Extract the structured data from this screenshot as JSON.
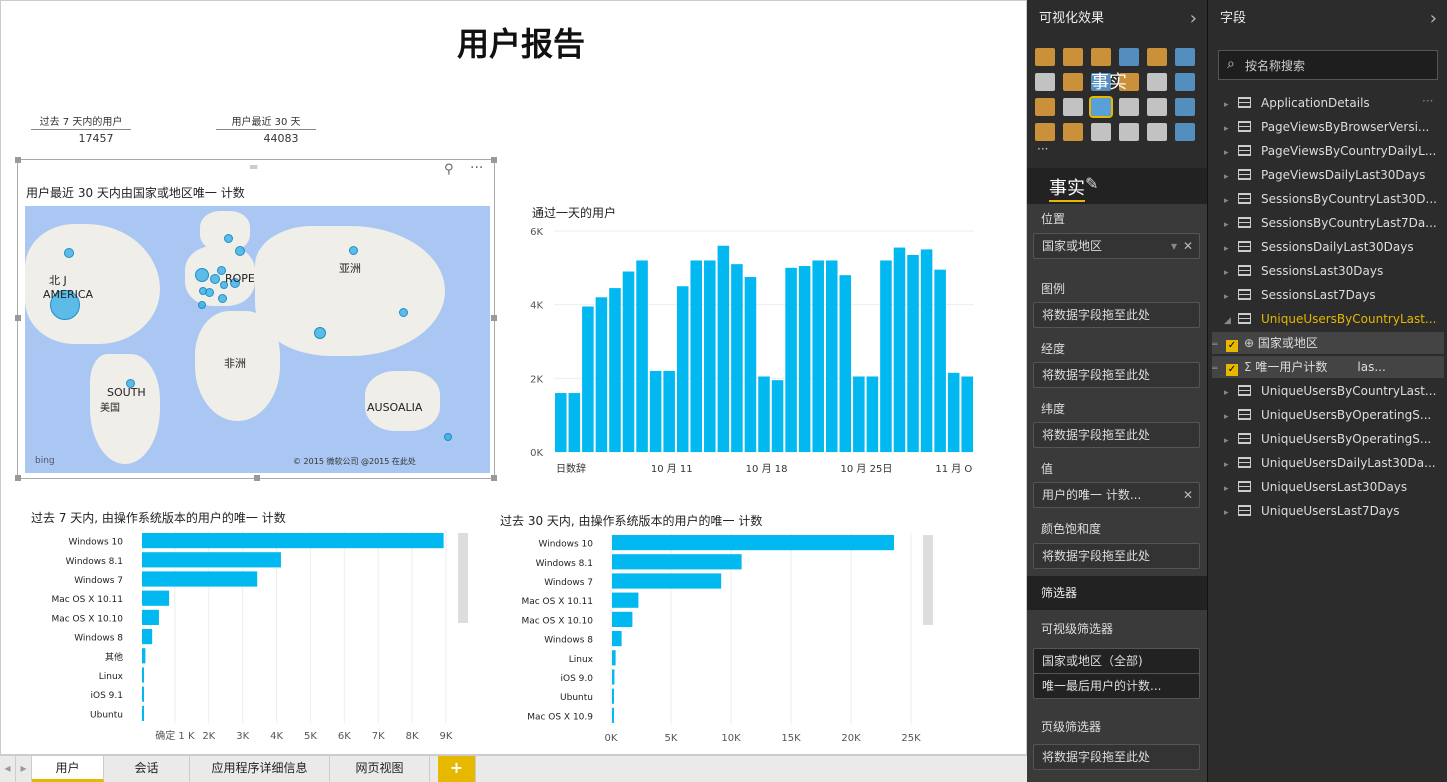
{
  "report": {
    "title": "用户报告"
  },
  "cards": [
    {
      "label": "过去 7 天内的用户",
      "value": "17457"
    },
    {
      "label": "用户最近 30 天",
      "value": "44083"
    }
  ],
  "map": {
    "title": "用户最近 30 天内由国家或地区唯一 计数",
    "labels": [
      "北 J",
      "AMERICA",
      "ROPE",
      "亚洲",
      "非洲",
      "SOUTH",
      "美国",
      "AUSOALIA"
    ],
    "attribution": "© 2015 微软公司 @2015 在此处",
    "bing": "bing"
  },
  "chart_data": [
    {
      "type": "bar",
      "title": "通过一天的用户",
      "yticks": [
        "0K",
        "2K",
        "4K",
        "6K"
      ],
      "xticks": [
        "日数辞",
        "10 月 11",
        "10 月 18",
        "10 月 25日",
        "11 月 O"
      ],
      "ylim": [
        0,
        6000
      ],
      "values": [
        1600,
        1600,
        3950,
        4200,
        4450,
        4900,
        5200,
        2200,
        2200,
        4500,
        5200,
        5200,
        5600,
        5100,
        4750,
        2050,
        1950,
        5000,
        5050,
        5200,
        5200,
        4800,
        2050,
        2050,
        5200,
        5550,
        5350,
        5500,
        4950,
        2150,
        2050
      ]
    },
    {
      "type": "bar",
      "orientation": "horizontal",
      "title": "过去 7 天内, 由操作系统版本的用户的唯一 计数",
      "categories": [
        "Windows 10",
        "Windows 8.1",
        "Windows 7",
        "Mac OS X 10.11",
        "Mac OS X 10.10",
        "Windows 8",
        "其他",
        "Linux",
        "iOS 9.1",
        "Ubuntu"
      ],
      "values": [
        8900,
        4100,
        3400,
        800,
        500,
        300,
        100,
        60,
        40,
        30
      ],
      "xticks": [
        "确定 1 K",
        "2K",
        "3K",
        "4K",
        "5K",
        "6K",
        "7K",
        "8K",
        "9K"
      ],
      "xlim": [
        0,
        9000
      ]
    },
    {
      "type": "bar",
      "orientation": "horizontal",
      "title": "过去 30 天内, 由操作系统版本的用户的唯一 计数",
      "categories": [
        "Windows 10",
        "Windows 8.1",
        "Mac OS X 10.11",
        "Mac OS X 10.10",
        "Windows 8",
        "Linux",
        "iOS 9.0",
        "Ubuntu",
        "Mac OS X 10.9"
      ],
      "values": [
        23500,
        10800,
        9100,
        2200,
        1700,
        800,
        300,
        200,
        100,
        50
      ],
      "xticks": [
        "0K",
        "5K",
        "10K",
        "15K",
        "20K",
        "25K"
      ],
      "xlim": [
        0,
        25000
      ]
    }
  ],
  "chart2_categories": [
    "Windows 10",
    "Windows 8.1",
    "Windows 7",
    "Mac OS X 10.11",
    "Mac OS X 10.10",
    "Windows 8",
    "Linux",
    "iOS 9.0",
    "Ubuntu",
    "Mac OS X 10.9"
  ],
  "tabs": [
    "用户",
    "会话",
    "应用程序详细信息",
    "网页视图",
    "+"
  ],
  "vis": {
    "title": "可视化效果",
    "overlay": "事实",
    "fmt": "事实",
    "sections": {
      "location": "位置",
      "legend": "图例",
      "longitude": "经度",
      "latitude": "纬度",
      "value": "值",
      "saturation": "颜色饱和度",
      "filters": "筛选器",
      "visual_filters": "可视级筛选器",
      "page_filters": "页级筛选器"
    },
    "wells": {
      "location": "国家或地区",
      "legend": "将数据字段拖至此处",
      "longitude": "将数据字段拖至此处",
      "latitude": "将数据字段拖至此处",
      "value": "用户的唯一 计数...",
      "saturation": "将数据字段拖至此处",
      "filter1": "国家或地区（全部)",
      "filter2": "唯一最后用户的计数...",
      "page": "将数据字段拖至此处"
    }
  },
  "fields": {
    "title": "字段",
    "search_placeholder": "按名称搜索",
    "tables": [
      "ApplicationDetails",
      "PageViewsByBrowserVersi...",
      "PageViewsByCountryDailyL...",
      "PageViewsDailyLast30Days",
      "SessionsByCountryLast30D...",
      "SessionsByCountryLast7Da...",
      "SessionsDailyLast30Days",
      "SessionsLast30Days",
      "SessionsLast7Days"
    ],
    "expanded": "UniqueUsersByCountryLast...",
    "sub": [
      "国家或地区",
      "唯一用户计数",
      "las..."
    ],
    "tables2": [
      "UniqueUsersByCountryLast...",
      "UniqueUsersByOperatingS...",
      "UniqueUsersByOperatingS...",
      "UniqueUsersDailyLast30Da...",
      "UniqueUsersLast30Days",
      "UniqueUsersLast7Days"
    ]
  },
  "colors": {
    "bar": "#01b8f0",
    "accent": "#e6b800",
    "panel": "#2c2c2c"
  }
}
